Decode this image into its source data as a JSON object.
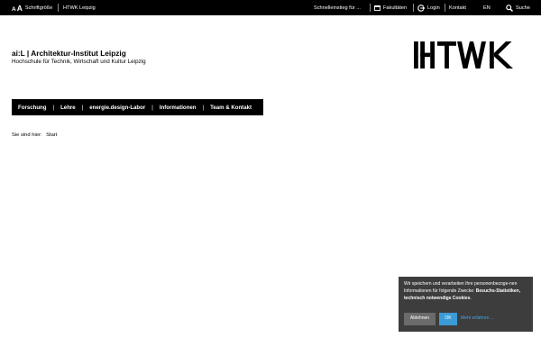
{
  "topbar": {
    "font_size_label": "Schriftgröße",
    "htwk_link": "HTWK Leipzig",
    "quick_access": "Schnelleinstieg für ...",
    "faculties": "Fakultäten",
    "login": "Login",
    "contact": "Kontakt",
    "language": "EN",
    "search": "Suche"
  },
  "header": {
    "title": "ai:L | Architektur-Institut Leipzig",
    "subtitle": "Hochschule für Technik, Wirtschaft und Kultur Leipzig",
    "logo_text": "HTWK"
  },
  "nav": {
    "items": [
      "Forschung",
      "Lehre",
      "energie.design-Labor",
      "Informationen",
      "Team & Kontakt"
    ],
    "separator": "|"
  },
  "breadcrumb": {
    "label": "Sie sind hier:",
    "current": "Start"
  },
  "cookie": {
    "text_prefix": "Wir speichern und verarbeiten Ihre personenbezoge-nen Informationen für folgende Zwecke:",
    "text_bold": "Besuchs-Statistiken, technisch notwendige Cookies",
    "text_suffix": ".",
    "reject_label": "Ablehnen",
    "ok_label": "OK",
    "more_label": "Mehr erfahren ..."
  },
  "colors": {
    "topbar_bg": "#000000",
    "nav_bg": "#000000",
    "cookie_bg": "#3d3d3d",
    "ok_button": "#3a9bd6",
    "reject_button": "#6b6b6b",
    "link_blue": "#4aa3e0"
  }
}
